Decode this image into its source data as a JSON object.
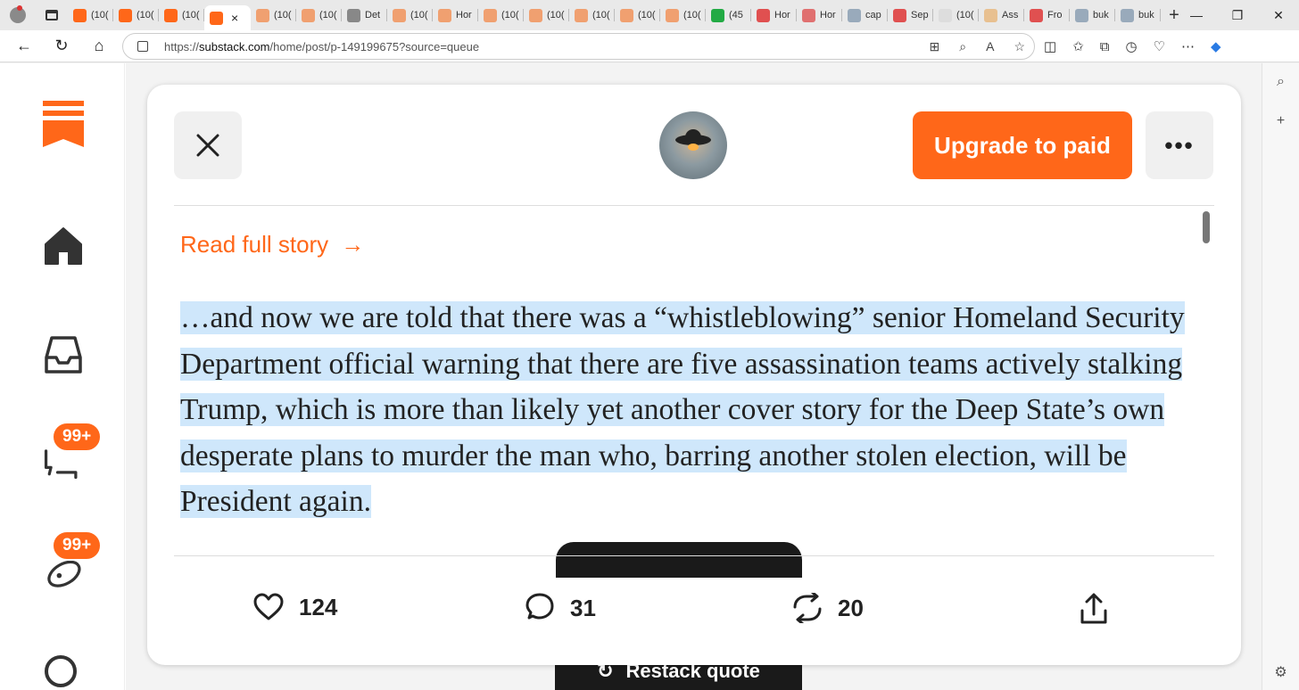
{
  "browser": {
    "tabs": [
      {
        "label": "(10(",
        "fav": "#ff6719"
      },
      {
        "label": "(10(",
        "fav": "#ff6719"
      },
      {
        "label": "(10(",
        "fav": "#ff6719"
      },
      {
        "label": "",
        "fav": "#ff6719",
        "active": true
      },
      {
        "label": "(10(",
        "fav": "#f0a070"
      },
      {
        "label": "(10(",
        "fav": "#f0a070"
      },
      {
        "label": "Det",
        "fav": "#888888"
      },
      {
        "label": "(10(",
        "fav": "#f0a070"
      },
      {
        "label": "Hor",
        "fav": "#f0a070"
      },
      {
        "label": "(10(",
        "fav": "#f0a070"
      },
      {
        "label": "(10(",
        "fav": "#f0a070"
      },
      {
        "label": "(10(",
        "fav": "#f0a070"
      },
      {
        "label": "(10(",
        "fav": "#f0a070"
      },
      {
        "label": "(10(",
        "fav": "#f0a070"
      },
      {
        "label": "(45",
        "fav": "#22aa44"
      },
      {
        "label": "Hor",
        "fav": "#e05050"
      },
      {
        "label": "Hor",
        "fav": "#e07070"
      },
      {
        "label": "cap",
        "fav": "#9ab"
      },
      {
        "label": "Sep",
        "fav": "#e05050"
      },
      {
        "label": "(10(",
        "fav": "#ddd"
      },
      {
        "label": "Ass",
        "fav": "#e8c090"
      },
      {
        "label": "Fro",
        "fav": "#e05050"
      },
      {
        "label": "buk",
        "fav": "#9ab"
      },
      {
        "label": "buk",
        "fav": "#9ab"
      }
    ],
    "tab_close": "×",
    "new_tab": "+",
    "url_scheme": "https://",
    "url_host": "substack.com",
    "url_path": "/home/post/p-149199675?source=queue"
  },
  "nav": {
    "inbox_badge": "99+",
    "activity_badge": "99+"
  },
  "modal": {
    "upgrade_label": "Upgrade to paid",
    "more_label": "•••",
    "read_full_story": "Read full story",
    "read_arrow": "→",
    "story_text": "…and now we are told that there was a “whistleblowing” senior Homeland Security Department official warning that there are five assassination teams actively stalking Trump, which is more than likely yet another cover story for the Deep State’s own desperate plans to murder the man who, barring another stolen election, will be President again.",
    "likes": "124",
    "comments": "31",
    "restacks": "20"
  },
  "background": {
    "restack_quote_label": "Restack quote"
  },
  "colors": {
    "brand": "#ff6719",
    "highlight": "#cfe7fb"
  }
}
